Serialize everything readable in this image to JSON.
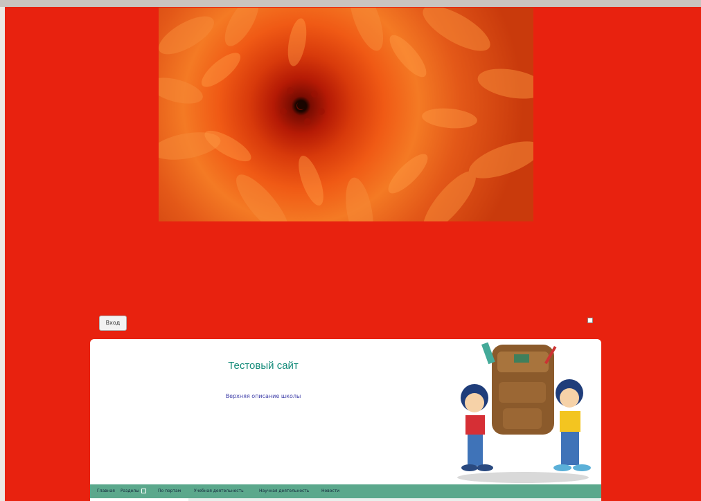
{
  "login": {
    "label": "Вход"
  },
  "site": {
    "title": "Тестовый сайт",
    "subtitle": "Верхняя описание школы"
  },
  "nav": {
    "items": [
      {
        "label": "Главная"
      },
      {
        "label": "Разделы"
      },
      {
        "label": "По портам"
      },
      {
        "label": "Учебная деятельность"
      },
      {
        "label": "Научная деятельность"
      },
      {
        "label": "Новости"
      }
    ]
  },
  "colors": {
    "page_background": "#e8220f",
    "navbar": "#5ba88c",
    "title": "#118a78",
    "subtitle": "#3e3ea8"
  },
  "icons": {
    "hero": "orange-chrysanthemum-image",
    "header": "kids-with-backpack-illustration"
  }
}
